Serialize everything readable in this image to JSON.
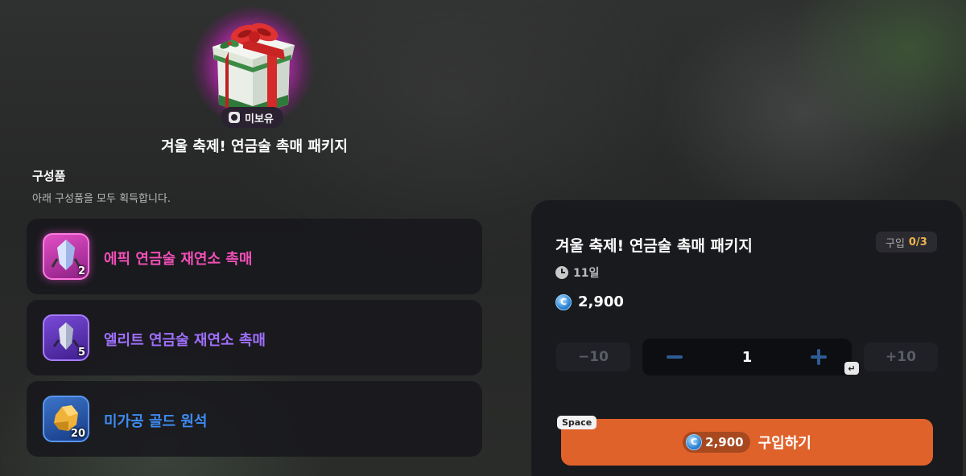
{
  "package": {
    "ownership_badge": "미보유",
    "title": "겨울 축제! 연금술 촉매 패키지"
  },
  "components": {
    "heading": "구성품",
    "subtitle": "아래 구성품을 모두 획득합니다.",
    "items": [
      {
        "name": "에픽 연금술 재연소 촉매",
        "qty": "2",
        "icon": "epic-crystal-icon",
        "color": "#f24fb7"
      },
      {
        "name": "엘리트 연금술 재연소 촉매",
        "qty": "5",
        "icon": "elite-crystal-icon",
        "color": "#a070ff"
      },
      {
        "name": "미가공 골드 원석",
        "qty": "20",
        "icon": "gold-ore-icon",
        "color": "#3e8bf1"
      }
    ]
  },
  "purchase": {
    "title": "겨울 축제! 연금술 촉매 패키지",
    "limit_label": "구입",
    "limit_value": "0/3",
    "time_left": "11일",
    "price": "2,900",
    "minus10": "−10",
    "plus10": "+10",
    "quantity": "1",
    "enter_key": "↵",
    "space_key": "Space",
    "buy_price": "2,900",
    "buy_label": "구입하기",
    "accent_color": "#e0622b"
  }
}
